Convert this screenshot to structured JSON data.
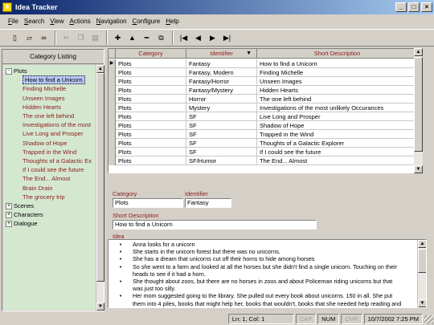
{
  "window": {
    "title": "Idea Tracker"
  },
  "menu": [
    {
      "pre": "",
      "u": "F",
      "post": "ile"
    },
    {
      "pre": "",
      "u": "S",
      "post": "earch"
    },
    {
      "pre": "",
      "u": "V",
      "post": "iew"
    },
    {
      "pre": "",
      "u": "A",
      "post": "ctions"
    },
    {
      "pre": "",
      "u": "N",
      "post": "avigation"
    },
    {
      "pre": "",
      "u": "C",
      "post": "onfigure"
    },
    {
      "pre": "",
      "u": "H",
      "post": "elp"
    }
  ],
  "left_pane": {
    "header": "Category Listing",
    "tree": [
      {
        "label": "Plots",
        "level": 0,
        "expander": "-"
      },
      {
        "label": "How to find a Unicorn",
        "level": 1,
        "selected": true
      },
      {
        "label": "Finding Michelle",
        "level": 1
      },
      {
        "label": "Unseen Images",
        "level": 1
      },
      {
        "label": "Hidden Hearts",
        "level": 1
      },
      {
        "label": "The one left behind",
        "level": 1
      },
      {
        "label": "Investigations of the most",
        "level": 1
      },
      {
        "label": "Live Long and Prosper",
        "level": 1
      },
      {
        "label": "Shadow of Hope",
        "level": 1
      },
      {
        "label": "Trapped in the Wind",
        "level": 1
      },
      {
        "label": "Thoughts of a Galactic Ex",
        "level": 1
      },
      {
        "label": "If I could see the future",
        "level": 1
      },
      {
        "label": "The End... Almost",
        "level": 1
      },
      {
        "label": "Brain Drain",
        "level": 1
      },
      {
        "label": "The grocery trip",
        "level": 1
      },
      {
        "label": "Scenes",
        "level": 0,
        "expander": "+"
      },
      {
        "label": "Characters",
        "level": 0,
        "expander": "+"
      },
      {
        "label": "Dialogue",
        "level": 0,
        "expander": "+"
      }
    ]
  },
  "grid": {
    "columns": [
      "Category",
      "Identifier",
      "Short Description"
    ],
    "rows": [
      [
        "Plots",
        "Fantasy",
        "How to find a Unicorn"
      ],
      [
        "Plots",
        "Fantasy, Modern",
        "Finding Michelle"
      ],
      [
        "Plots",
        "Fantasy/Horror",
        "Unseen Images"
      ],
      [
        "Plots",
        "Fantasy/Mystery",
        "Hidden Hearts"
      ],
      [
        "Plots",
        "Horror",
        "The one left behind"
      ],
      [
        "Plots",
        "Mystery",
        "Investigations of the most unlikely Occurances"
      ],
      [
        "Plots",
        "SF",
        "Live Long and Prosper"
      ],
      [
        "Plots",
        "SF",
        "Shadow of Hope"
      ],
      [
        "Plots",
        "SF",
        "Trapped in the Wind"
      ],
      [
        "Plots",
        "SF",
        "Thoughts of a Galactic Explorer"
      ],
      [
        "Plots",
        "SF",
        "If I could see the future"
      ],
      [
        "Plots",
        "SF/Humor",
        "The End... Almost"
      ]
    ]
  },
  "detail": {
    "category_label": "Category",
    "category_value": "Plots",
    "identifier_label": "Identifier",
    "identifier_value": "Fantasy",
    "short_desc_label": "Short Description",
    "short_desc_value": "How to find a Unicorn",
    "idea_label": "Idea",
    "idea_lines": [
      {
        "bullet": "•",
        "text": "Anna looks for a unicorn"
      },
      {
        "bullet": "•",
        "text": "She starts in the unicorn forest but there was no unicorns."
      },
      {
        "bullet": "•",
        "text": "She has a dream that unicorns cut off their horns to hide among horses"
      },
      {
        "bullet": "•",
        "text": "So she went to a farm and looked at all the horses but she didn't find a single unicorn.  Touching on their"
      },
      {
        "bullet": "",
        "text": "heads to see if it had a horn."
      },
      {
        "bullet": "•",
        "text": "She thought about zoos,  but there are no horses in zoos and about Policeman riding unicorns but that"
      },
      {
        "bullet": "",
        "text": "was just too silly."
      },
      {
        "bullet": "•",
        "text": "Her mom suggested going to the library.  She pulled out every book about unicorns.  150 in all.  She put"
      },
      {
        "bullet": "",
        "text": "them into 4 piles, books that might help her, books that wouldn't, books that she needed help reading and"
      }
    ]
  },
  "status": {
    "position": "Ln: 1, Col: 1",
    "cap": "CAP",
    "num": "NUM",
    "ovr": "OVR",
    "datetime": "10/7/2002 7:25 PM"
  }
}
